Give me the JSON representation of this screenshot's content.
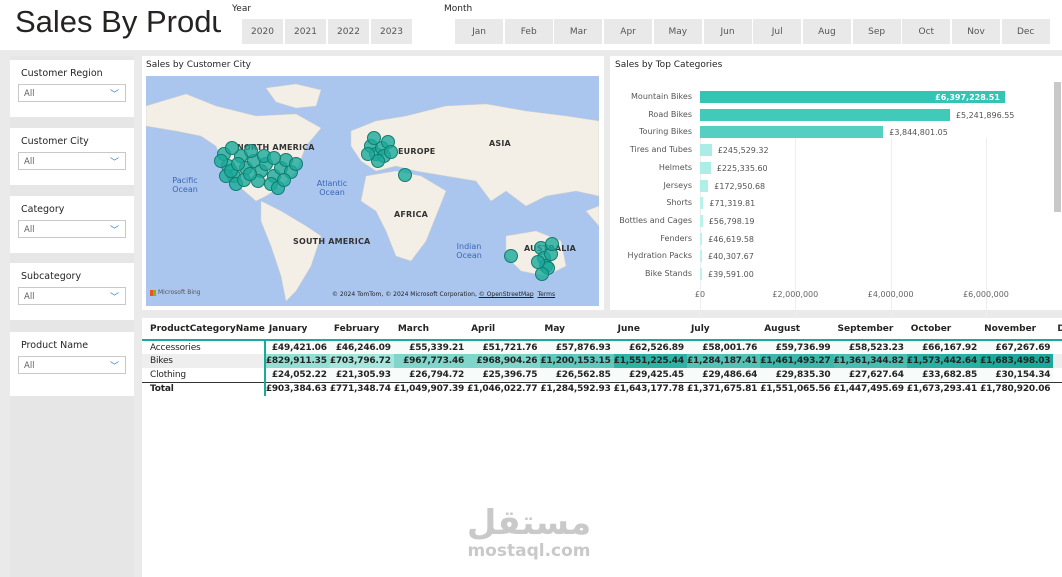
{
  "header": {
    "title": "Sales By Product",
    "year_label": "Year",
    "years": [
      "2020",
      "2021",
      "2022",
      "2023"
    ],
    "month_label": "Month",
    "months": [
      "Jan",
      "Feb",
      "Mar",
      "Apr",
      "May",
      "Jun",
      "Jul",
      "Aug",
      "Sep",
      "Oct",
      "Nov",
      "Dec"
    ]
  },
  "filters": [
    {
      "label": "Customer Region",
      "value": "All"
    },
    {
      "label": "Customer City",
      "value": "All"
    },
    {
      "label": "Category",
      "value": "All"
    },
    {
      "label": "Subcategory",
      "value": "All"
    },
    {
      "label": "Product Name",
      "value": "All"
    }
  ],
  "map": {
    "title": "Sales by Customer City",
    "labels": {
      "north_america": "NORTH AMERICA",
      "europe": "EUROPE",
      "asia": "ASIA",
      "africa": "AFRICA",
      "south_america": "SOUTH AMERICA",
      "australia": "AUSTRALIA",
      "pacific": "Pacific Ocean",
      "atlantic": "Atlantic Ocean",
      "indian": "Indian Ocean"
    },
    "logo": "Microsoft Bing",
    "attribution": "© 2024 TomTom, © 2024 Microsoft Corporation,",
    "osm_link": "© OpenStreetMap",
    "terms_link": "Terms",
    "bubble_color": "#1aa99a"
  },
  "chart_data": [
    {
      "type": "bar",
      "orientation": "horizontal",
      "title": "Sales by Top Categories",
      "categories": [
        "Mountain Bikes",
        "Road Bikes",
        "Touring Bikes",
        "Tires and Tubes",
        "Helmets",
        "Jerseys",
        "Shorts",
        "Bottles and Cages",
        "Fenders",
        "Hydration Packs",
        "Bike Stands"
      ],
      "values": [
        6397228.51,
        5241896.55,
        3844801.05,
        245529.32,
        225335.6,
        172950.68,
        71319.81,
        56798.19,
        46619.58,
        40307.67,
        39591.0
      ],
      "data_labels": [
        "£6,397,228.51",
        "£5,241,896.55",
        "£3,844,801.05",
        "£245,529.32",
        "£225,335.60",
        "£172,950.68",
        "£71,319.81",
        "£56,798.19",
        "£46,619.58",
        "£40,307.67",
        "£39,591.00"
      ],
      "xticks": [
        "£0",
        "£2,000,000",
        "£4,000,000",
        "£6,000,000"
      ],
      "xlim": [
        0,
        7000000
      ],
      "grid": true,
      "colors": {
        "max": "#33c4b4",
        "min": "#c8f7f2"
      }
    }
  ],
  "table": {
    "headers": [
      "ProductCategoryName",
      "January",
      "February",
      "March",
      "April",
      "May",
      "June",
      "July",
      "August",
      "September",
      "October",
      "November",
      "December"
    ],
    "rows": [
      {
        "name": "Accessories",
        "values": [
          "£49,421.06",
          "£46,246.09",
          "£55,339.21",
          "£51,721.76",
          "£57,876.93",
          "£62,526.89",
          "£58,001.76",
          "£59,736.99",
          "£58,523.23",
          "£66,167.92",
          "£67,267.69",
          ""
        ]
      },
      {
        "name": "Bikes",
        "values": [
          "£829,911.35",
          "£703,796.72",
          "£967,773.46",
          "£968,904.26",
          "£1,200,153.15",
          "£1,551,225.44",
          "£1,284,187.41",
          "£1,461,493.27",
          "£1,361,344.82",
          "£1,573,442.64",
          "£1,683,498.03",
          ""
        ]
      },
      {
        "name": "Clothing",
        "values": [
          "£24,052.22",
          "£21,305.93",
          "£26,794.72",
          "£25,396.75",
          "£26,562.85",
          "£29,425.45",
          "£29,486.64",
          "£29,835.30",
          "£27,627.64",
          "£33,682.85",
          "£30,154.34",
          ""
        ]
      },
      {
        "name": "Total",
        "values": [
          "£903,384.63",
          "£771,348.74",
          "£1,049,907.39",
          "£1,046,022.77",
          "£1,284,592.93",
          "£1,643,177.78",
          "£1,371,675.81",
          "£1,551,065.56",
          "£1,447,495.69",
          "£1,673,293.41",
          "£1,780,920.06",
          ""
        ]
      }
    ],
    "highlight_color": "#1aa99a"
  },
  "watermark": {
    "text": "مستقل",
    "url": "mostaql.com"
  }
}
